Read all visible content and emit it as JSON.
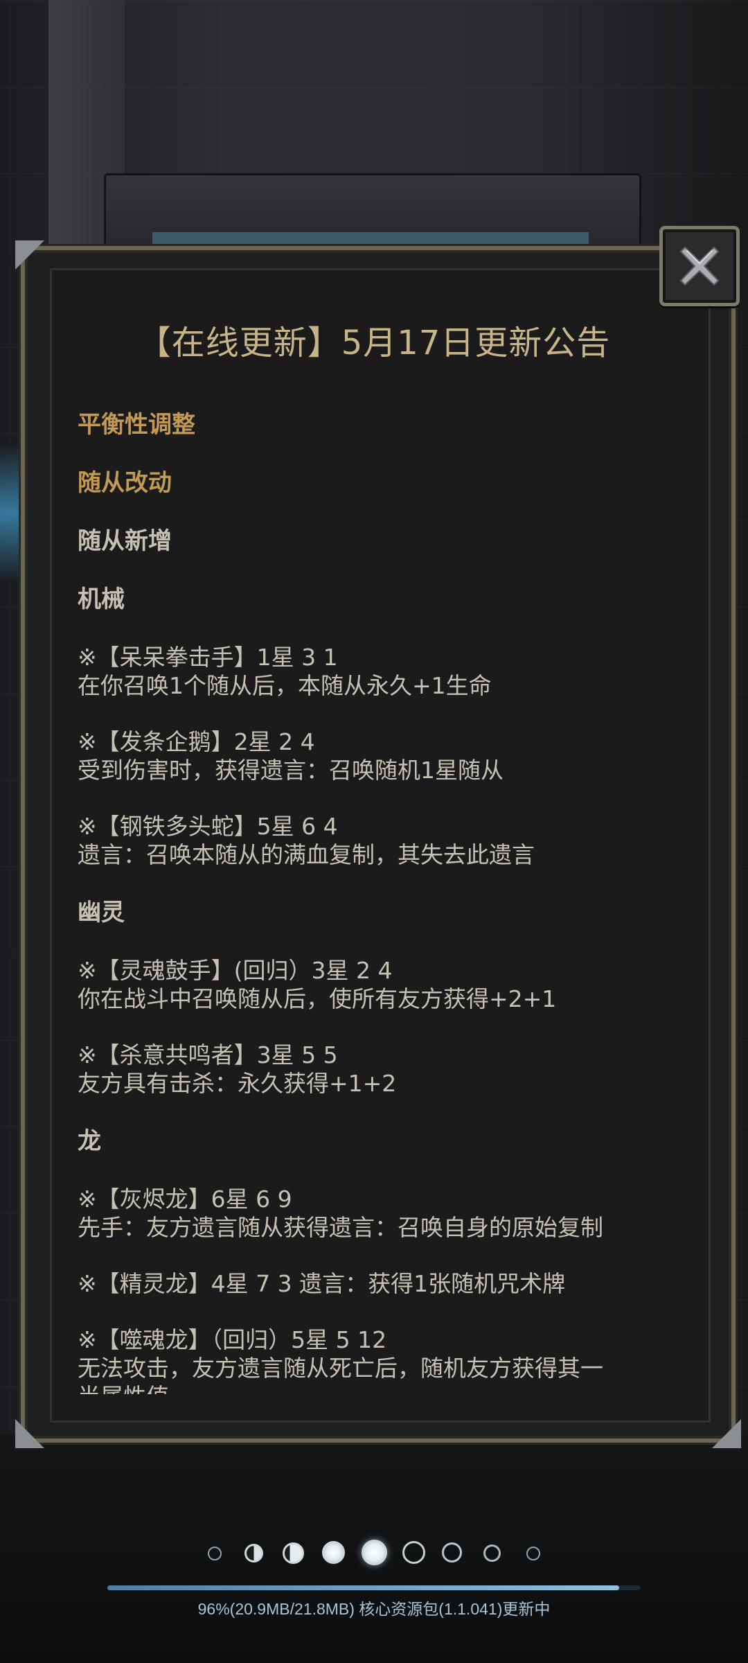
{
  "announcement": {
    "title": "【在线更新】5月17日更新公告",
    "close_icon": "close-icon",
    "sections": {
      "h1": "平衡性调整",
      "h2": "随从改动",
      "h3": "随从新增",
      "h4": "机械",
      "m1a": "※【呆呆拳击手】1星 3 1",
      "m1b": "在你召唤1个随从后，本随从永久+1生命",
      "m2a": "※【发条企鹅】2星 2 4",
      "m2b": "受到伤害时，获得遗言：召唤随机1星随从",
      "m3a": "※【钢铁多头蛇】5星 6 4",
      "m3b": "遗言：召唤本随从的满血复制，其失去此遗言",
      "h5": "幽灵",
      "g1a": "※【灵魂鼓手】(回归）3星 2 4",
      "g1b": "你在战斗中召唤随从后，使所有友方获得+2+1",
      "g2a": "※【杀意共鸣者】3星 5 5",
      "g2b": "友方具有击杀：永久获得+1+2",
      "h6": "龙",
      "d1a": "※【灰烬龙】6星 6 9",
      "d1b": "先手：友方遗言随从获得遗言：召唤自身的原始复制",
      "d2a": "※【精灵龙】4星 7 3 遗言：获得1张随机咒术牌",
      "d3a": "※【噬魂龙】（回归）5星 5 12",
      "d3b": "无法攻击，友方遗言随从死亡后，随机友方获得其一",
      "d3c": "半属性值"
    }
  },
  "colors": {
    "gold_header": "#c39a55",
    "title_text": "#c9b489",
    "body_text": "#c7c1b4",
    "progress_text": "#a8c4d8"
  },
  "pagination": {
    "count": 9,
    "current": 5
  },
  "progress": {
    "fraction": 0.96,
    "text": "96%(20.9MB/21.8MB)    核心资源包(1.1.041)更新中"
  }
}
